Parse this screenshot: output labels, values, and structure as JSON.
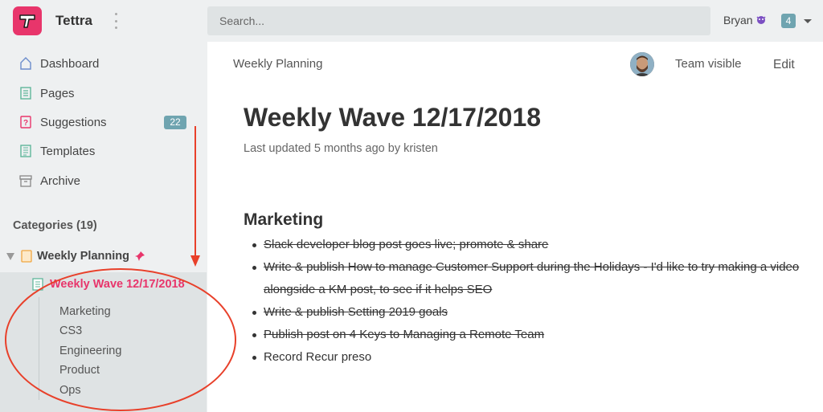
{
  "header": {
    "app_name": "Tettra",
    "search_placeholder": "Search...",
    "user_name": "Bryan",
    "notification_count": "4"
  },
  "sidebar": {
    "nav": [
      {
        "label": "Dashboard",
        "icon": "home-icon"
      },
      {
        "label": "Pages",
        "icon": "page-icon"
      },
      {
        "label": "Suggestions",
        "icon": "question-icon",
        "badge": "22"
      },
      {
        "label": "Templates",
        "icon": "template-icon"
      },
      {
        "label": "Archive",
        "icon": "archive-icon"
      }
    ],
    "categories_label": "Categories (19)",
    "category": "Weekly Planning",
    "active_page": "Weekly Wave 12/17/2018",
    "toc": [
      "Marketing",
      "CS3",
      "Engineering",
      "Product",
      "Ops"
    ]
  },
  "main": {
    "breadcrumb": "Weekly Planning",
    "visibility": "Team visible",
    "edit_label": "Edit",
    "title": "Weekly Wave 12/17/2018",
    "updated": "Last updated 5 months ago by kristen",
    "section": "Marketing",
    "items": [
      {
        "text": "Slack developer blog post goes live; promote & share",
        "done": true
      },
      {
        "text": "Write & publish How to manage Customer Support during the Holidays - I'd like to try making a video",
        "done": true
      },
      {
        "text": "alongside a KM post, to see if it helps SEO",
        "done": true,
        "continuation": true
      },
      {
        "text": "Write & publish Setting 2019 goals",
        "done": true
      },
      {
        "text": "Publish post on 4 Keys to Managing a Remote Team",
        "done": true
      },
      {
        "text": "Record Recur preso",
        "done": false
      }
    ]
  },
  "colors": {
    "brand": "#e8356b",
    "badge": "#6fa4b0",
    "annotation": "#e8402a"
  }
}
